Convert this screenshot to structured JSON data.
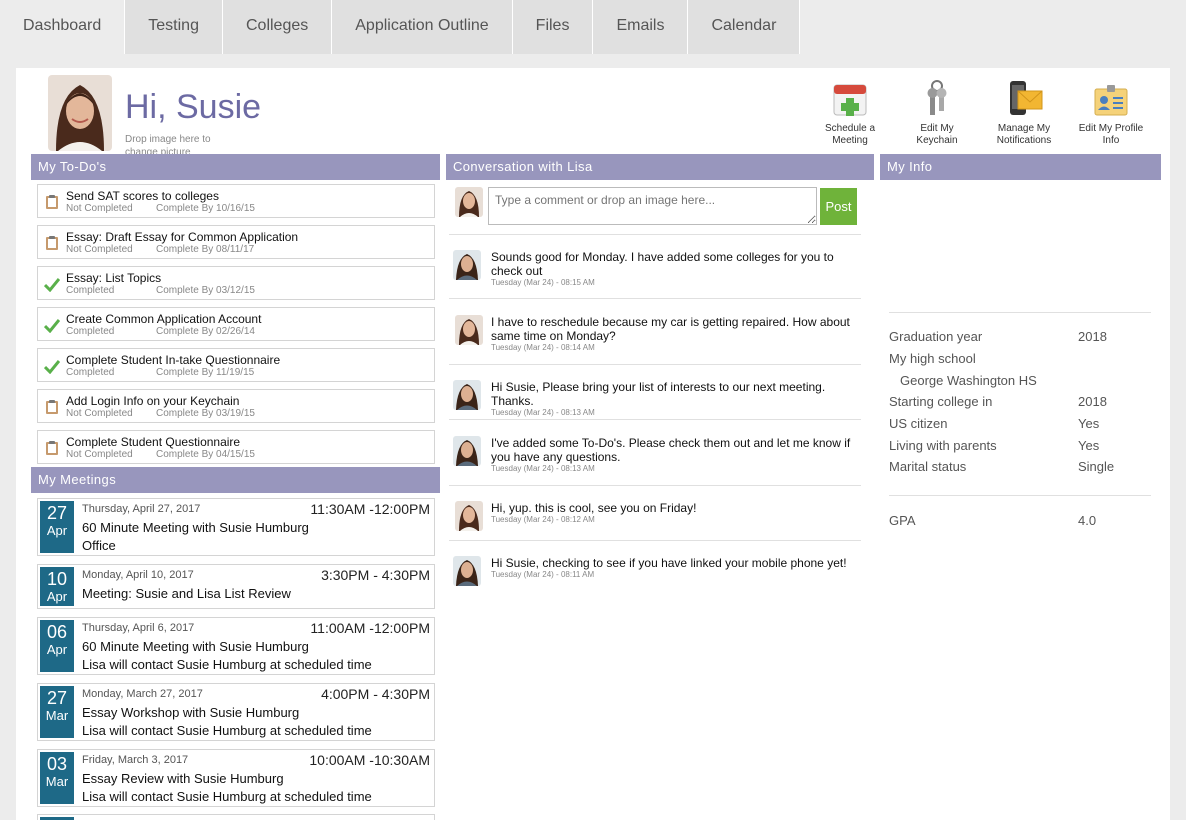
{
  "tabs": [
    "Dashboard",
    "Testing",
    "Colleges",
    "Application Outline",
    "Files",
    "Emails",
    "Calendar"
  ],
  "header": {
    "greeting": "Hi, Susie",
    "drop_hint": "Drop image here to change picture"
  },
  "actions": [
    {
      "label": "Schedule a Meeting",
      "icon": "calendar-add-icon"
    },
    {
      "label": "Edit My Keychain",
      "icon": "keychain-icon"
    },
    {
      "label": "Manage My Notifications",
      "icon": "notification-icon"
    },
    {
      "label": "Edit My Profile Info",
      "icon": "profile-card-icon"
    }
  ],
  "todos": {
    "heading": "My To-Do's",
    "items": [
      {
        "title": "Send SAT scores to colleges",
        "status": "Not Completed",
        "due": "Complete By 10/16/15",
        "icon": "clipboard-icon"
      },
      {
        "title": "Essay: Draft Essay for Common Application",
        "status": "Not Completed",
        "due": "Complete By 08/11/17",
        "icon": "clipboard-icon"
      },
      {
        "title": "Essay: List Topics",
        "status": "Completed",
        "due": "Complete By 03/12/15",
        "icon": "check-icon"
      },
      {
        "title": "Create Common Application Account",
        "status": "Completed",
        "due": "Complete By 02/26/14",
        "icon": "check-icon"
      },
      {
        "title": "Complete Student In-take Questionnaire",
        "status": "Completed",
        "due": "Complete By 11/19/15",
        "icon": "check-icon"
      },
      {
        "title": "Add Login Info on your Keychain",
        "status": "Not Completed",
        "due": "Complete By 03/19/15",
        "icon": "clipboard-icon"
      },
      {
        "title": "Complete Student Questionnaire",
        "status": "Not Completed",
        "due": "Complete By 04/15/15",
        "icon": "clipboard-icon"
      }
    ]
  },
  "meetings": {
    "heading": "My Meetings",
    "items": [
      {
        "day": "27",
        "month": "Apr",
        "when": "Thursday, April 27, 2017",
        "time": "11:30AM -12:00PM",
        "title": "60 Minute Meeting with Susie Humburg",
        "sub": "Office"
      },
      {
        "day": "10",
        "month": "Apr",
        "when": "Monday, April 10, 2017",
        "time": "3:30PM - 4:30PM",
        "title": "Meeting: Susie and Lisa List Review",
        "sub": ""
      },
      {
        "day": "06",
        "month": "Apr",
        "when": "Thursday, April 6, 2017",
        "time": "11:00AM -12:00PM",
        "title": "60 Minute Meeting with Susie Humburg",
        "sub": "Lisa will contact Susie Humburg at scheduled time"
      },
      {
        "day": "27",
        "month": "Mar",
        "when": "Monday, March 27, 2017",
        "time": "4:00PM - 4:30PM",
        "title": "Essay Workshop with Susie Humburg",
        "sub": "Lisa will contact Susie Humburg at scheduled time"
      },
      {
        "day": "03",
        "month": "Mar",
        "when": "Friday, March 3, 2017",
        "time": "10:00AM -10:30AM",
        "title": "Essay Review with Susie Humburg",
        "sub": "Lisa will contact Susie Humburg at scheduled time"
      }
    ]
  },
  "conversation": {
    "heading": "Conversation with Lisa",
    "placeholder": "Type a comment or drop an image here...",
    "post_label": "Post",
    "messages": [
      {
        "from": "Lisa",
        "text": "Sounds good for Monday. I have added some colleges for you to check out",
        "time": "Tuesday (Mar 24) - 08:15 AM"
      },
      {
        "from": "Susie",
        "text": "I have to reschedule because my car is getting repaired. How about same time on Monday?",
        "time": "Tuesday (Mar 24) - 08:14 AM"
      },
      {
        "from": "Lisa",
        "text": "Hi Susie, Please bring your list of interests to our next meeting. Thanks.",
        "time": "Tuesday (Mar 24) - 08:13 AM"
      },
      {
        "from": "Lisa",
        "text": "I've added some To-Do's. Please check them out and let me know if you have any questions.",
        "time": "Tuesday (Mar 24) - 08:13 AM"
      },
      {
        "from": "Susie",
        "text": "Hi, yup. this is cool, see you on Friday!",
        "time": "Tuesday (Mar 24) - 08:12 AM"
      },
      {
        "from": "Lisa",
        "text": "Hi Susie, checking to see if you have linked your mobile phone yet!",
        "time": "Tuesday (Mar 24) - 08:11 AM"
      }
    ]
  },
  "info": {
    "heading": "My Info",
    "rows": [
      {
        "label": "Graduation year",
        "value": "2018"
      },
      {
        "label": "My high school",
        "value": ""
      },
      {
        "label": "George Washington HS",
        "value": ""
      },
      {
        "label": "Starting college in",
        "value": "2018"
      },
      {
        "label": "US citizen",
        "value": "Yes"
      },
      {
        "label": "Living with parents",
        "value": "Yes"
      },
      {
        "label": "Marital status",
        "value": "Single"
      }
    ],
    "gpa": {
      "label": "GPA",
      "value": "4.0"
    }
  },
  "colors": {
    "accent": "#9896bd",
    "date_badge": "#1e6987",
    "post_button": "#6fb33a",
    "greeting": "#6c6aa3"
  }
}
